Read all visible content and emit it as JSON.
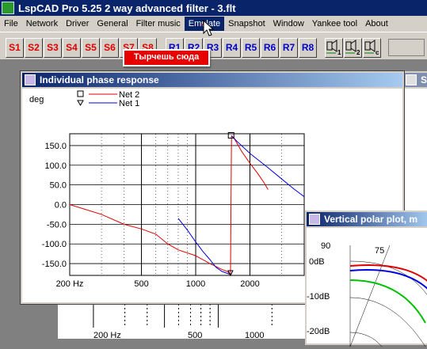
{
  "window": {
    "title": "LspCAD Pro 5.25 2 way advanced filter - 3.flt"
  },
  "menu": [
    "File",
    "Network",
    "Driver",
    "General",
    "Filter music",
    "Emulate",
    "Snapshot",
    "Window",
    "Yankee tool",
    "About"
  ],
  "toolbar": {
    "s_buttons": [
      "S1",
      "S2",
      "S3",
      "S4",
      "S5",
      "S6",
      "S7",
      "S8"
    ],
    "r_buttons": [
      "R1",
      "R2",
      "R3",
      "R4",
      "R5",
      "R6",
      "R7",
      "R8"
    ],
    "icon_buttons": [
      "driver-1-icon",
      "driver-2-icon",
      "driver-c-icon"
    ]
  },
  "callout": "Тырчешь сюда",
  "phase_window": {
    "title": "Individual phase response",
    "y_unit": "deg",
    "legend": [
      {
        "name": "Net 2",
        "marker": "□",
        "color": "#e00000"
      },
      {
        "name": "Net 1",
        "marker": "▽",
        "color": "#0000e0"
      }
    ]
  },
  "small_window": {
    "title": "S"
  },
  "polar_window": {
    "title": "Vertical polar plot, m",
    "angle_labels": [
      "90",
      "75"
    ],
    "db_labels": [
      "0dB",
      "-10dB",
      "-20dB"
    ]
  },
  "bottom_strip": {
    "x_labels": [
      "200 Hz",
      "500",
      "1000"
    ]
  },
  "chart_data": {
    "type": "line",
    "title": "",
    "xlabel": "",
    "ylabel": "deg",
    "xscale": "log",
    "xlim": [
      200,
      4000
    ],
    "ylim": [
      -180,
      180
    ],
    "x_tick_labels": [
      "200 Hz",
      "500",
      "1000",
      "2000"
    ],
    "y_tick_labels": [
      "150.0",
      "100.0",
      "50.0",
      "0.0",
      "-50.0",
      "-100.0",
      "-150.0"
    ],
    "y_ticks": [
      150,
      100,
      50,
      0,
      -50,
      -100,
      -150
    ],
    "grid": true,
    "legend_position": "top-left",
    "series": [
      {
        "name": "Net 2",
        "color": "#e00000",
        "points": [
          [
            200,
            0
          ],
          [
            300,
            -25
          ],
          [
            400,
            -50
          ],
          [
            500,
            -62
          ],
          [
            600,
            -75
          ],
          [
            700,
            -100
          ],
          [
            800,
            -115
          ],
          [
            1000,
            -130
          ],
          [
            1200,
            -150
          ],
          [
            1400,
            -165
          ],
          [
            1500,
            -170
          ],
          [
            1560,
            -178
          ],
          [
            1580,
            175
          ],
          [
            1650,
            165
          ],
          [
            1800,
            135
          ],
          [
            2000,
            105
          ],
          [
            2200,
            80
          ],
          [
            2400,
            55
          ],
          [
            2520,
            38
          ]
        ]
      },
      {
        "name": "Net 1",
        "color": "#0000e0",
        "points": [
          [
            800,
            -35
          ],
          [
            900,
            -65
          ],
          [
            1000,
            -95
          ],
          [
            1100,
            -120
          ],
          [
            1200,
            -140
          ],
          [
            1300,
            -160
          ],
          [
            1400,
            -170
          ],
          [
            1500,
            -175
          ],
          [
            1560,
            -178
          ],
          [
            1580,
            175
          ],
          [
            1700,
            160
          ],
          [
            2000,
            130
          ],
          [
            2500,
            95
          ],
          [
            3000,
            65
          ],
          [
            3500,
            40
          ],
          [
            4000,
            20
          ]
        ]
      }
    ]
  }
}
